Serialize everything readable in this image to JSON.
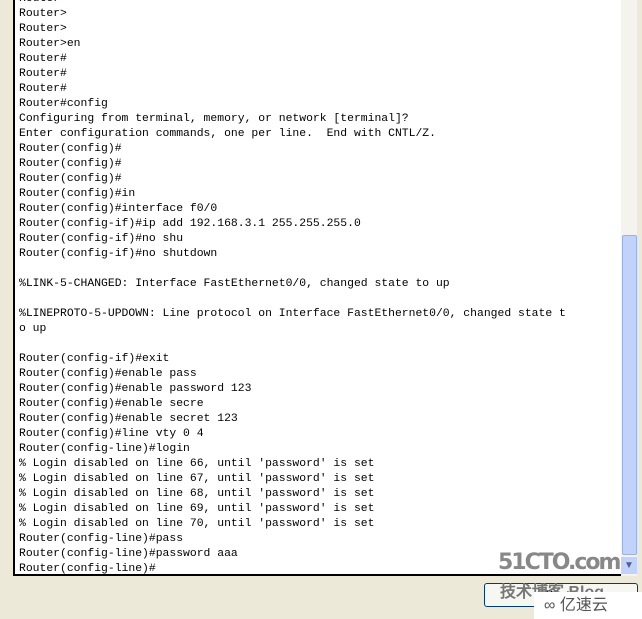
{
  "terminal": {
    "lines": [
      "Router>",
      "Router>",
      "Router>",
      "Router>en",
      "Router#",
      "Router#",
      "Router#",
      "Router#config",
      "Configuring from terminal, memory, or network [terminal]?",
      "Enter configuration commands, one per line.  End with CNTL/Z.",
      "Router(config)#",
      "Router(config)#",
      "Router(config)#",
      "Router(config)#in",
      "Router(config)#interface f0/0",
      "Router(config-if)#ip add 192.168.3.1 255.255.255.0",
      "Router(config-if)#no shu",
      "Router(config-if)#no shutdown",
      "",
      "%LINK-5-CHANGED: Interface FastEthernet0/0, changed state to up",
      "",
      "%LINEPROTO-5-UPDOWN: Line protocol on Interface FastEthernet0/0, changed state t",
      "o up",
      "",
      "Router(config-if)#exit",
      "Router(config)#enable pass",
      "Router(config)#enable password 123",
      "Router(config)#enable secre",
      "Router(config)#enable secret 123",
      "Router(config)#line vty 0 4",
      "Router(config-line)#login",
      "% Login disabled on line 66, until 'password' is set",
      "% Login disabled on line 67, until 'password' is set",
      "% Login disabled on line 68, until 'password' is set",
      "% Login disabled on line 69, until 'password' is set",
      "% Login disabled on line 70, until 'password' is set",
      "Router(config-line)#pass",
      "Router(config-line)#password aaa",
      "Router(config-line)#"
    ]
  },
  "scrollbar": {
    "position_fraction": 1.0,
    "down_arrow": "chevron-down-icon"
  },
  "button": {
    "label": "Paste"
  },
  "watermark": {
    "text1": "51CTO.com",
    "text2": "技术博客 Blog",
    "text3": "亿速云"
  }
}
